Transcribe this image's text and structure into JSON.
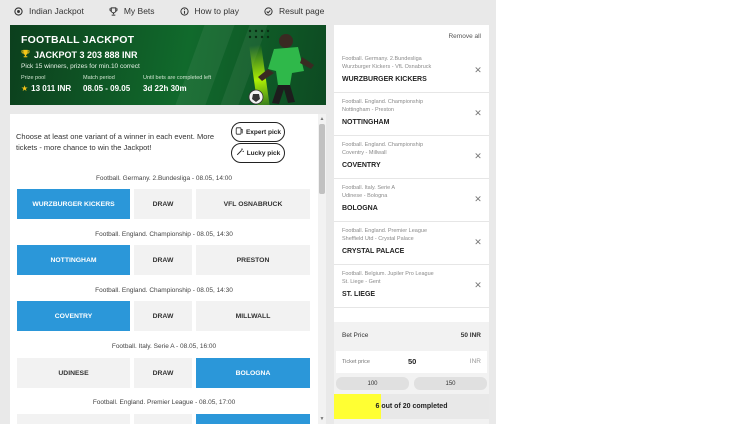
{
  "nav": {
    "items": [
      {
        "label": "Indian Jackpot",
        "icon": "target-icon"
      },
      {
        "label": "My Bets",
        "icon": "trophy-icon"
      },
      {
        "label": "How to play",
        "icon": "info-icon"
      },
      {
        "label": "Result page",
        "icon": "check-circle-icon"
      }
    ]
  },
  "banner": {
    "title": "FOOTBALL JACKPOT",
    "jackpot": "JACKPOT 3 203 888 INR",
    "description": "Pick 15 winners, prizes for min.10 correct",
    "prize_pool_label": "Prize pool",
    "prize_pool_value": "13 011 INR",
    "match_period_label": "Match period",
    "match_period_value": "08.05 - 09.05",
    "until_label": "Until bets are completed left",
    "until_value": "3d 22h 30m"
  },
  "main": {
    "intro": "Choose at least one variant of a winner in each event. More tickets - more chance to win the Jackpot!",
    "expert_pick": "Expert pick",
    "lucky_pick": "Lucky pick",
    "events": [
      {
        "title": "Football. Germany. 2.Bundesliga - 08.05, 14:00",
        "home": "WURZBURGER KICKERS",
        "draw": "DRAW",
        "away": "VFL OSNABRUCK",
        "selected": "home"
      },
      {
        "title": "Football. England. Championship - 08.05, 14:30",
        "home": "NOTTINGHAM",
        "draw": "DRAW",
        "away": "PRESTON",
        "selected": "home"
      },
      {
        "title": "Football. England. Championship - 08.05, 14:30",
        "home": "COVENTRY",
        "draw": "DRAW",
        "away": "MILLWALL",
        "selected": "home"
      },
      {
        "title": "Football. Italy. Serie A - 08.05, 16:00",
        "home": "UDINESE",
        "draw": "DRAW",
        "away": "BOLOGNA",
        "selected": "away"
      },
      {
        "title": "Football. England. Premier League - 08.05, 17:00",
        "home": "",
        "draw": "",
        "away": "",
        "selected": "away"
      }
    ]
  },
  "sidebar": {
    "remove_all": "Remove all",
    "bets": [
      {
        "league": "Football. Germany. 2.Bundesliga",
        "match": "Wurzburger Kickers - VfL Osnabruck",
        "pick": "WURZBURGER KICKERS"
      },
      {
        "league": "Football. England. Championship",
        "match": "Nottingham - Preston",
        "pick": "NOTTINGHAM"
      },
      {
        "league": "Football. England. Championship",
        "match": "Coventry - Millwall",
        "pick": "COVENTRY"
      },
      {
        "league": "Football. Italy. Serie A",
        "match": "Udinese - Bologna",
        "pick": "BOLOGNA"
      },
      {
        "league": "Football. England. Premier League",
        "match": "Sheffield Utd - Crystal Palace",
        "pick": "CRYSTAL PALACE"
      },
      {
        "league": "Football. Belgium. Jupiler Pro League",
        "match": "St. Liege - Gent",
        "pick": "ST. LIEGE"
      }
    ],
    "bet_price_label": "Bet Price",
    "bet_price_value": "50 INR",
    "ticket_price_label": "Ticket price",
    "ticket_price_value": "50",
    "ticket_currency": "INR",
    "preset_1": "100",
    "preset_2": "150",
    "progress_text": "6 out of 20 completed",
    "progress_completed": 6,
    "progress_total": 20
  },
  "colors": {
    "selected": "#2b97d9",
    "banner_green": "#116a2c",
    "progress": "#ffff33"
  }
}
